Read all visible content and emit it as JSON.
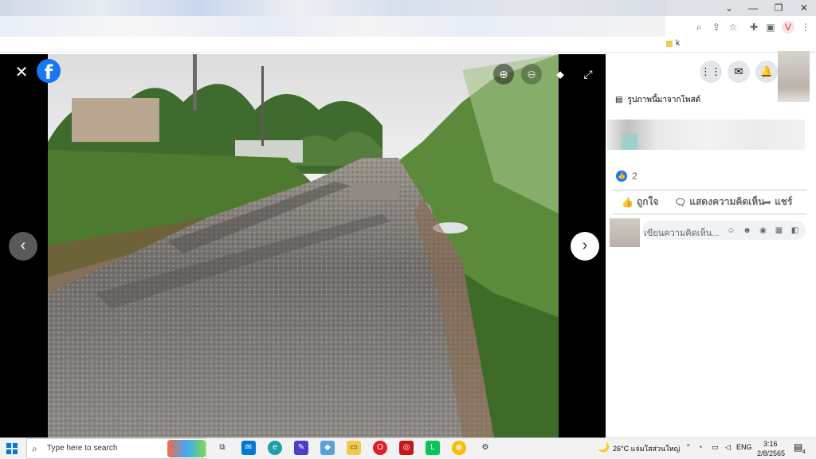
{
  "browser": {
    "controls": {
      "minimize": "—",
      "maximize": "❐",
      "close": "✕",
      "chevron": "⌄"
    },
    "toolbar_icons": [
      "zoom-icon",
      "share-icon",
      "star-icon",
      "extensions-icon",
      "sidepanel-icon",
      "profile-icon",
      "menu-icon"
    ],
    "bookmark_label": "k"
  },
  "viewer": {
    "close_label": "✕",
    "fb_logo": "f",
    "zoom_in": "⊕",
    "zoom_out": "⊖",
    "tag": "⬥",
    "fullscreen": "⤢",
    "prev": "‹",
    "next": "›"
  },
  "panel": {
    "header_icons": {
      "menu": "⋮⋮",
      "messenger": "✉",
      "notifications": "🔔"
    },
    "post_source": "รูปภาพนี้มาจากโพสต์",
    "like_count": "2",
    "actions": {
      "like": "ถูกใจ",
      "comment": "แสดงความคิดเห็น",
      "share": "แชร์"
    },
    "comment_placeholder": "เขียนความคิดเห็น..."
  },
  "taskbar": {
    "search_placeholder": "Type here to search",
    "weather": "26°C  แจ่มใสส่วนใหญ่",
    "language": "ENG",
    "time": "3:16",
    "date": "2/8/2565",
    "notification_count": "4"
  },
  "colors": {
    "facebook_blue": "#1877f2",
    "taskbar": "#f2f2f2"
  }
}
